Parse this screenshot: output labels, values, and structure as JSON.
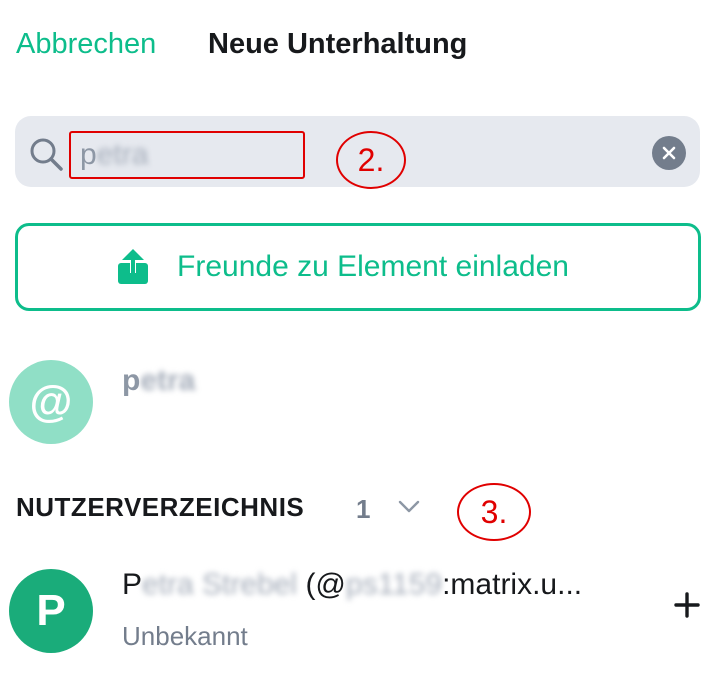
{
  "header": {
    "cancel_label": "Abbrechen",
    "title": "Neue Unterhaltung"
  },
  "search": {
    "value_visible": "p",
    "value_blurred": "etra",
    "icons": {
      "search": "search-icon",
      "clear": "clear-icon"
    }
  },
  "invite": {
    "label": "Freunde zu Element einladen",
    "icon": "share-icon"
  },
  "direct_match": {
    "avatar_symbol": "@",
    "name_visible": "p",
    "name_blurred": "etra"
  },
  "directory": {
    "header": "NUTZERVERZEICHNIS",
    "count": "1",
    "results": [
      {
        "avatar_letter": "P",
        "name_prefix": "P",
        "name_blurred": "etra Strebel",
        "id_prefix": " (@",
        "id_blurred": "ps1159",
        "id_suffix": ":matrix.u...",
        "status": "Unbekannt"
      }
    ]
  },
  "annotations": [
    "2.",
    "3."
  ],
  "colors": {
    "accent": "#0dbd8b",
    "search_bg": "#e6e9ef",
    "annotation": "#e00000"
  }
}
